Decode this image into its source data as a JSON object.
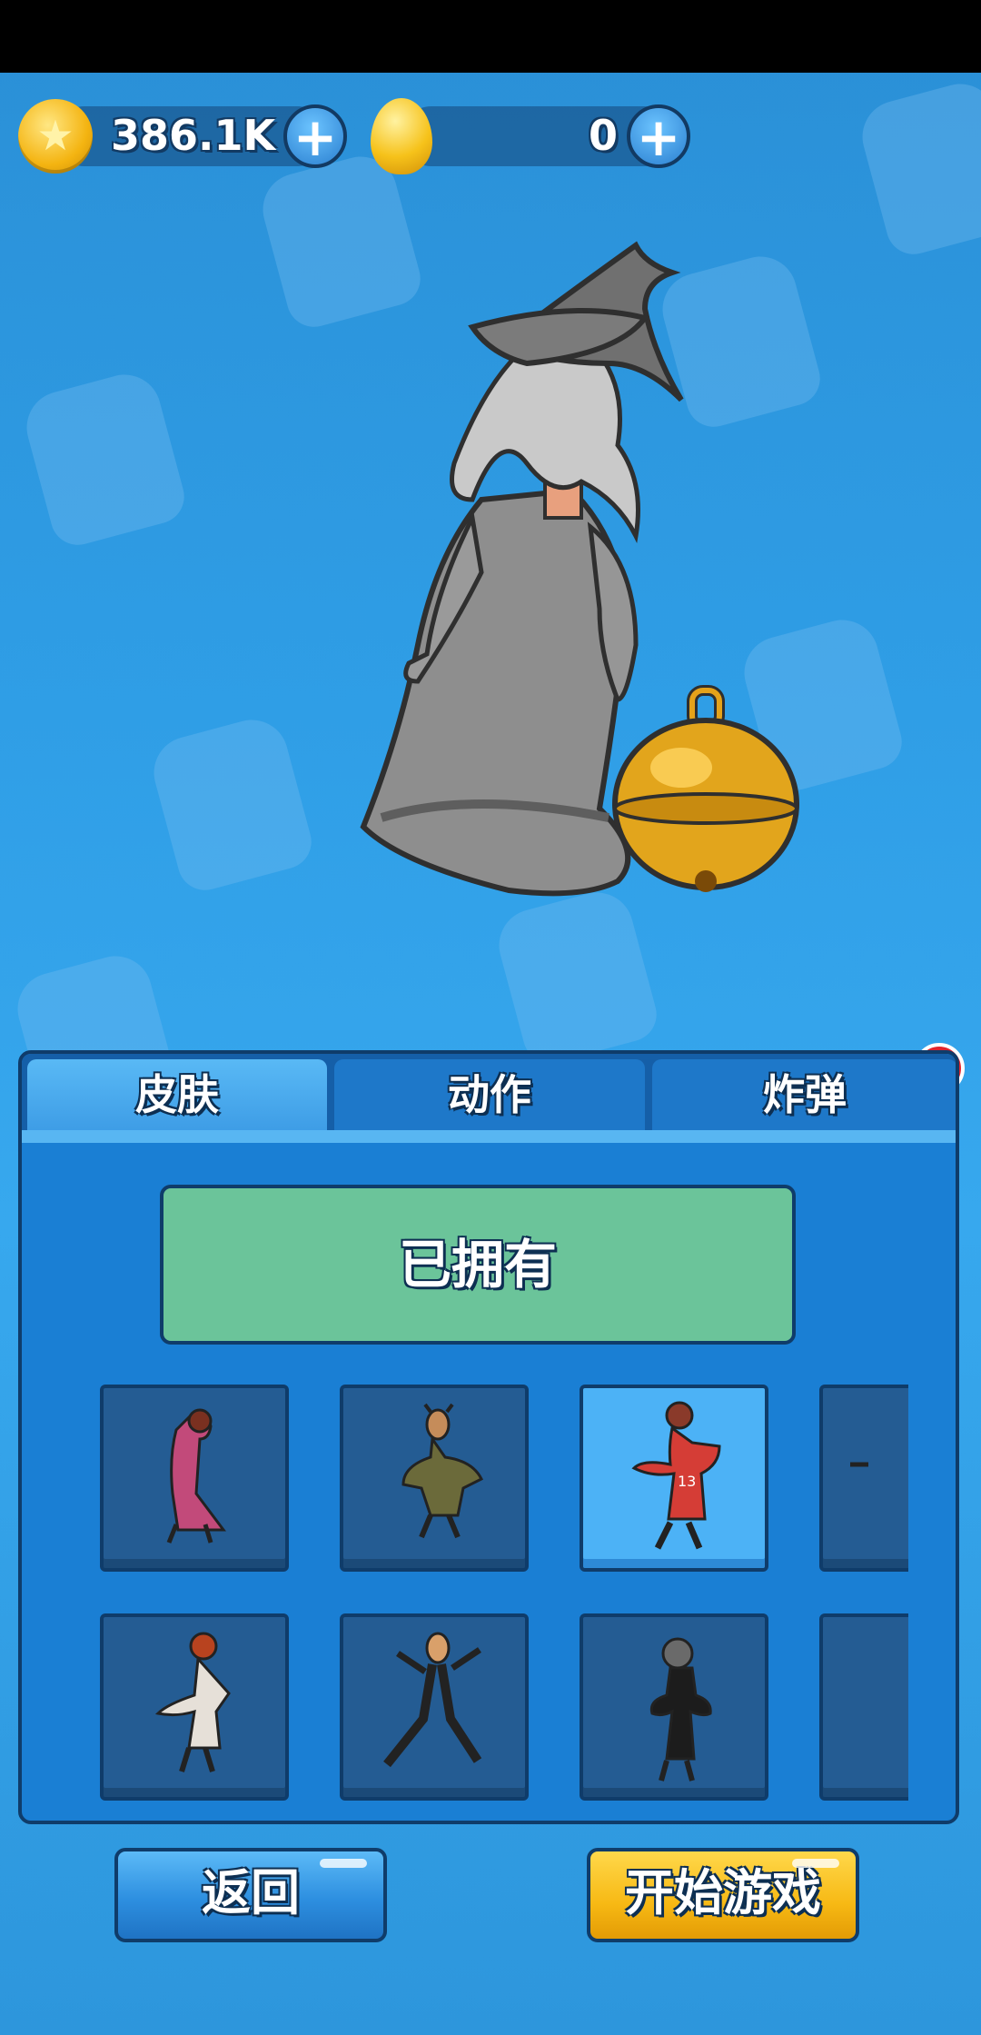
{
  "currency": {
    "coins": "386.1K",
    "eggs": "0"
  },
  "tabs": [
    {
      "label": "皮肤",
      "active": true
    },
    {
      "label": "动作",
      "active": false
    },
    {
      "label": "炸弹",
      "active": false
    }
  ],
  "alert_badge": "!",
  "owned_label": "已拥有",
  "skins": [
    {
      "name": "skin-red-robe",
      "selected": false
    },
    {
      "name": "skin-soldier",
      "selected": false
    },
    {
      "name": "skin-basketball",
      "jersey": "13",
      "selected": true
    },
    {
      "name": "skin-hidden-1",
      "selected": false
    },
    {
      "name": "skin-redhead",
      "selected": false
    },
    {
      "name": "skin-dancer",
      "selected": false
    },
    {
      "name": "skin-dark-suit",
      "selected": false
    },
    {
      "name": "skin-hidden-2",
      "selected": false
    }
  ],
  "buttons": {
    "back": "返回",
    "start": "开始游戏"
  },
  "colors": {
    "background": "#2f9ee6",
    "panel": "#1a7fd4",
    "owned": "#6bc49a",
    "start": "#f7b914",
    "back": "#2d8fe0"
  }
}
